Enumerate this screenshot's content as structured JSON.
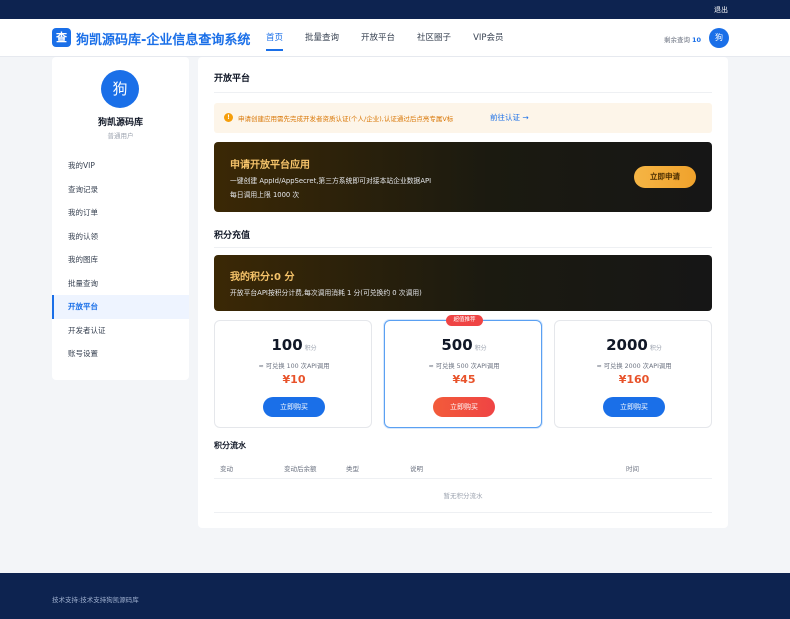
{
  "topbar": {
    "logout": "退出"
  },
  "header": {
    "logo_char": "查",
    "site_title": "狗凯源码库-企业信息查询系统",
    "nav": [
      "首页",
      "批量查询",
      "开放平台",
      "社区圈子",
      "VIP会员"
    ],
    "quota_label": "剩余查询",
    "quota_value": "10",
    "avatar_char": "狗"
  },
  "sidebar": {
    "avatar_char": "狗",
    "username": "狗凯源码库",
    "role": "普通用户",
    "menu": [
      "我的VIP",
      "查询记录",
      "我的订单",
      "我的认领",
      "我的图库",
      "批量查询",
      "开放平台",
      "开发者认证",
      "账号设置"
    ],
    "active_index": 6
  },
  "main": {
    "section_title": "开放平台",
    "notice": {
      "icon": "!",
      "text": "申请创建应用需先完成开发者资质认证(个人/企业),认证通过后点亮专属V标",
      "link": "前往认证 →"
    },
    "apply_banner": {
      "title": "申请开放平台应用",
      "desc": "一键创建 AppId/AppSecret,第三方系统即可对接本站企业数据API",
      "limit": "每日调用上限 1000 次",
      "button": "立即申请"
    },
    "recharge_title": "积分充值",
    "points_banner": {
      "title": "我的积分:0 分",
      "desc": "开放平台API按积分计费,每次调用消耗 1 分(可兑换约 0 次调用)"
    },
    "plans": [
      {
        "points": "100",
        "unit": "积分",
        "calls": "≈ 可兑换 100 次API调用",
        "price": "¥10",
        "button": "立即购买",
        "featured": false,
        "badge": ""
      },
      {
        "points": "500",
        "unit": "积分",
        "calls": "≈ 可兑换 500 次API调用",
        "price": "¥45",
        "button": "立即购买",
        "featured": true,
        "badge": "超值推荐"
      },
      {
        "points": "2000",
        "unit": "积分",
        "calls": "≈ 可兑换 2000 次API调用",
        "price": "¥160",
        "button": "立即购买",
        "featured": false,
        "badge": ""
      }
    ],
    "flow": {
      "title": "积分流水",
      "columns": [
        "变动",
        "变动后余额",
        "类型",
        "说明",
        "时间"
      ],
      "empty": "暂无积分流水"
    }
  },
  "footer": {
    "text": "技术支持:技术支持狗凯源码库"
  },
  "colors": {
    "primary": "#1a6fe8",
    "navy": "#0d2350",
    "gold": "#f5c36a",
    "price": "#e8532b"
  }
}
